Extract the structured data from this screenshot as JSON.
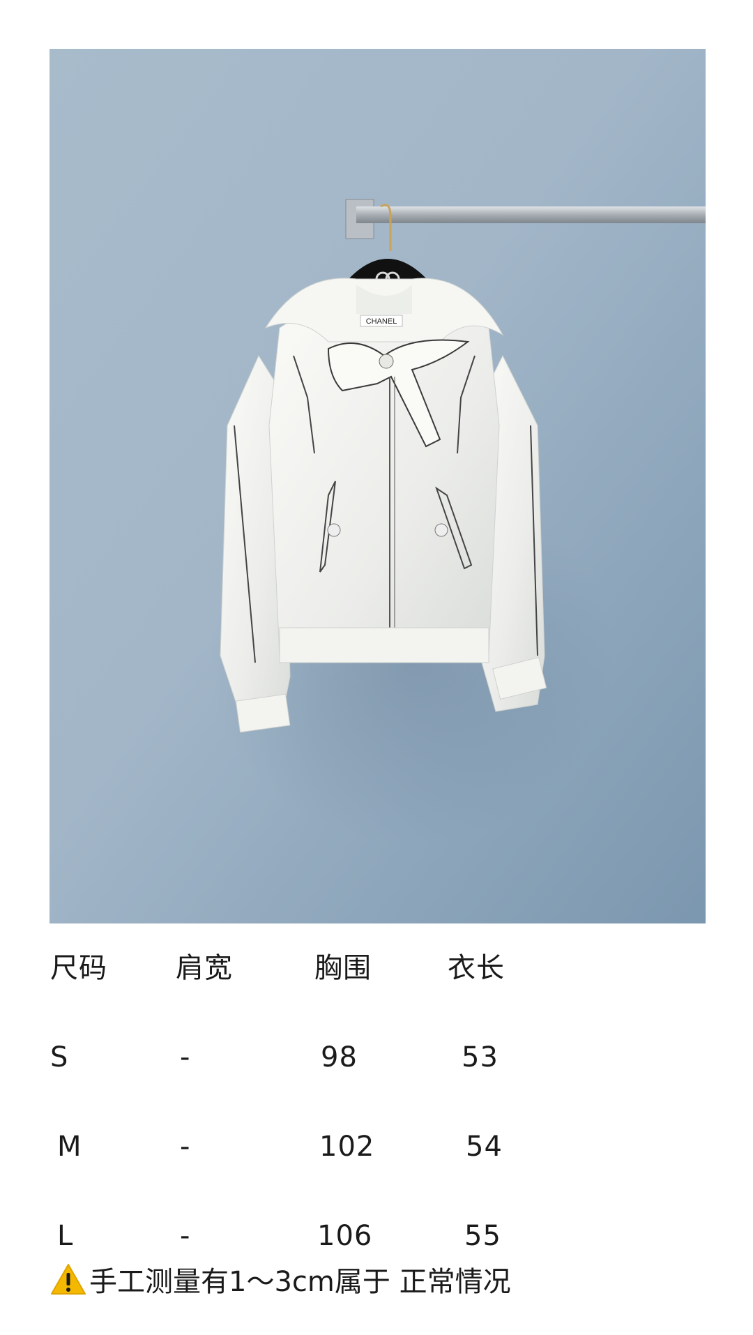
{
  "photo": {
    "alt": "",
    "label_brand": "CHANEL",
    "background_color": "#9fb3c5"
  },
  "size_table": {
    "headers": [
      "尺码",
      "肩宽",
      "胸围",
      "衣长"
    ],
    "rows": [
      [
        "S",
        "-",
        "98",
        "53"
      ],
      [
        "M",
        "-",
        "102",
        "54"
      ],
      [
        "L",
        "-",
        "106",
        "55"
      ]
    ]
  },
  "note": {
    "icon": "warning-icon",
    "text": "手工测量有1～3cm属于 正常情况"
  }
}
